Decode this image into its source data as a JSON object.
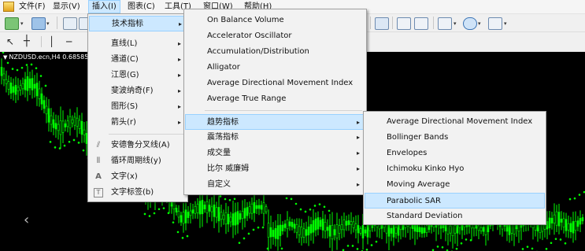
{
  "menubar": {
    "items": [
      "文件(F)",
      "显示(V)",
      "插入(I)",
      "图表(C)",
      "工具(T)",
      "窗口(W)",
      "帮助(H)"
    ],
    "active_index": 2
  },
  "chart": {
    "title": "NZDUSD.ecn,H4  0.68585  0",
    "colors": {
      "background": "#000000",
      "candle": "#00ff00",
      "sar_dots": "#00ff00"
    }
  },
  "insert_menu": {
    "items": [
      {
        "label": "技术指标",
        "submenu": true,
        "highlighted": true
      },
      {
        "label": "直线(L)",
        "submenu": true
      },
      {
        "label": "通道(C)",
        "submenu": true
      },
      {
        "label": "江恩(G)",
        "submenu": true
      },
      {
        "label": "斐波纳奇(F)",
        "submenu": true
      },
      {
        "label": "图形(S)",
        "submenu": true
      },
      {
        "label": "箭头(r)",
        "submenu": true
      },
      {
        "label": "安德鲁分叉线(A)",
        "icon": "andrews-pitchfork-icon"
      },
      {
        "label": "循环周期线(y)",
        "icon": "cycle-lines-icon"
      },
      {
        "label": "文字(x)",
        "icon": "text-icon"
      },
      {
        "label": "文字标签(b)",
        "icon": "text-label-icon"
      }
    ]
  },
  "indicators_menu": {
    "items": [
      {
        "label": "On Balance Volume"
      },
      {
        "label": "Accelerator Oscillator"
      },
      {
        "label": "Accumulation/Distribution"
      },
      {
        "label": "Alligator"
      },
      {
        "label": "Average Directional Movement Index"
      },
      {
        "label": "Average True Range"
      },
      {
        "label": "趋势指标",
        "submenu": true,
        "highlighted": true
      },
      {
        "label": "震荡指标",
        "submenu": true
      },
      {
        "label": "成交量",
        "submenu": true
      },
      {
        "label": "比尔 威廉姆",
        "submenu": true
      },
      {
        "label": "自定义",
        "submenu": true
      }
    ]
  },
  "trend_menu": {
    "items": [
      {
        "label": "Average Directional Movement Index"
      },
      {
        "label": "Bollinger Bands"
      },
      {
        "label": "Envelopes"
      },
      {
        "label": "Ichimoku Kinko Hyo"
      },
      {
        "label": "Moving Average"
      },
      {
        "label": "Parabolic SAR",
        "highlighted": true
      },
      {
        "label": "Standard Deviation"
      }
    ]
  },
  "icons": {
    "arrow_right": "▸",
    "chevron_left": "‹",
    "dropdown": "▾"
  }
}
